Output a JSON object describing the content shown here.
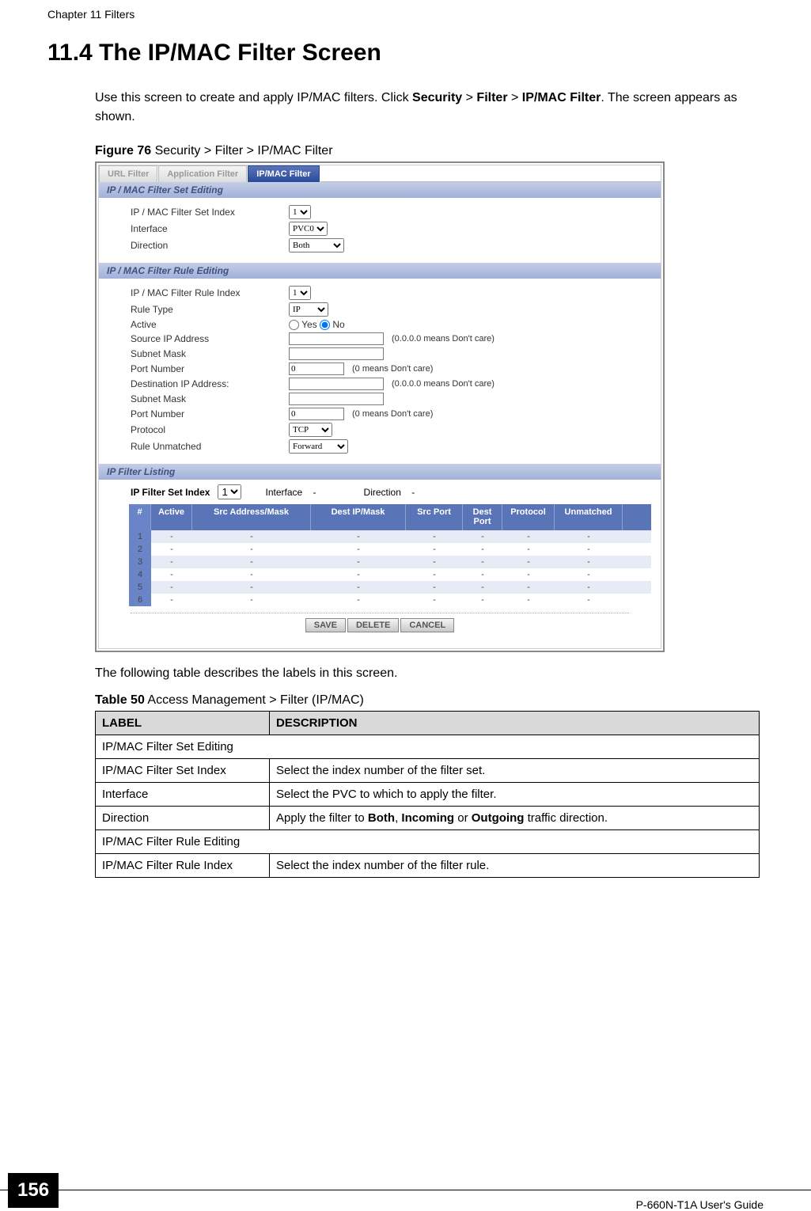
{
  "header": {
    "chapter": "Chapter 11 Filters"
  },
  "section_title": "11.4  The IP/MAC Filter Screen",
  "intro": {
    "t1": "Use this screen to create and apply IP/MAC filters. Click ",
    "b1": "Security",
    "t2": " > ",
    "b2": "Filter",
    "t3": " > ",
    "b3": "IP/MAC Filter",
    "t4": ". The screen appears as shown."
  },
  "figure": {
    "num": "Figure 76",
    "caption": "   Security > Filter > IP/MAC Filter"
  },
  "screenshot": {
    "tabs": {
      "url": "URL Filter",
      "app": "Application Filter",
      "ipmac": "IP/MAC Filter"
    },
    "section1": "IP / MAC Filter Set Editing",
    "set": {
      "index_label": "IP / MAC Filter Set Index",
      "index_value": "1",
      "interface_label": "Interface",
      "interface_value": "PVC0",
      "direction_label": "Direction",
      "direction_value": "Both"
    },
    "section2": "IP / MAC Filter Rule Editing",
    "rule": {
      "index_label": "IP / MAC Filter Rule Index",
      "index_value": "1",
      "ruletype_label": "Rule Type",
      "ruletype_value": "IP",
      "active_label": "Active",
      "active_yes": "Yes",
      "active_no": "No",
      "srcip_label": "Source IP Address",
      "srcip_hint": "(0.0.0.0 means Don't care)",
      "subnet1_label": "Subnet Mask",
      "port1_label": "Port Number",
      "port1_value": "0",
      "port_hint": "(0 means Don't care)",
      "dstip_label": "Destination IP Address:",
      "dstip_hint": "(0.0.0.0 means Don't care)",
      "subnet2_label": "Subnet Mask",
      "port2_label": "Port Number",
      "port2_value": "0",
      "protocol_label": "Protocol",
      "protocol_value": "TCP",
      "unmatched_label": "Rule Unmatched",
      "unmatched_value": "Forward"
    },
    "section3": "IP Filter Listing",
    "listing": {
      "setindex_label": "IP Filter Set Index",
      "setindex_value": "1",
      "interface_label": "Interface",
      "interface_value": "-",
      "direction_label": "Direction",
      "direction_value": "-",
      "headers": {
        "num": "#",
        "active": "Active",
        "src": "Src Address/Mask",
        "dst": "Dest IP/Mask",
        "sport": "Src Port",
        "dport": "Dest Port",
        "proto": "Protocol",
        "unm": "Unmatched"
      },
      "rows": [
        {
          "n": "1",
          "a": "-",
          "s": "-",
          "d": "-",
          "sp": "-",
          "dp": "-",
          "p": "-",
          "u": "-"
        },
        {
          "n": "2",
          "a": "-",
          "s": "-",
          "d": "-",
          "sp": "-",
          "dp": "-",
          "p": "-",
          "u": "-"
        },
        {
          "n": "3",
          "a": "-",
          "s": "-",
          "d": "-",
          "sp": "-",
          "dp": "-",
          "p": "-",
          "u": "-"
        },
        {
          "n": "4",
          "a": "-",
          "s": "-",
          "d": "-",
          "sp": "-",
          "dp": "-",
          "p": "-",
          "u": "-"
        },
        {
          "n": "5",
          "a": "-",
          "s": "-",
          "d": "-",
          "sp": "-",
          "dp": "-",
          "p": "-",
          "u": "-"
        },
        {
          "n": "6",
          "a": "-",
          "s": "-",
          "d": "-",
          "sp": "-",
          "dp": "-",
          "p": "-",
          "u": "-"
        }
      ]
    },
    "buttons": {
      "save": "SAVE",
      "delete": "DELETE",
      "cancel": "CANCEL"
    }
  },
  "after_fig": "The following table describes the labels in this screen.",
  "table": {
    "num": "Table 50",
    "caption": "   Access Management > Filter (IP/MAC)",
    "head_label": "LABEL",
    "head_desc": "DESCRIPTION",
    "rows": {
      "r1": "IP/MAC Filter Set Editing",
      "r2l": "IP/MAC Filter Set Index",
      "r2d": "Select the index number of the filter set.",
      "r3l": "Interface",
      "r3d": "Select the PVC to which to apply the filter.",
      "r4l": "Direction",
      "r4d_a": "Apply the filter to ",
      "r4d_b1": "Both",
      "r4d_c": ", ",
      "r4d_b2": "Incoming",
      "r4d_d": " or ",
      "r4d_b3": "Outgoing",
      "r4d_e": " traffic direction.",
      "r5": "IP/MAC Filter Rule Editing",
      "r6l": "IP/MAC Filter Rule Index",
      "r6d": "Select the index number of the filter rule."
    }
  },
  "footer": {
    "pagenum": "156",
    "guide": "P-660N-T1A User's Guide"
  }
}
